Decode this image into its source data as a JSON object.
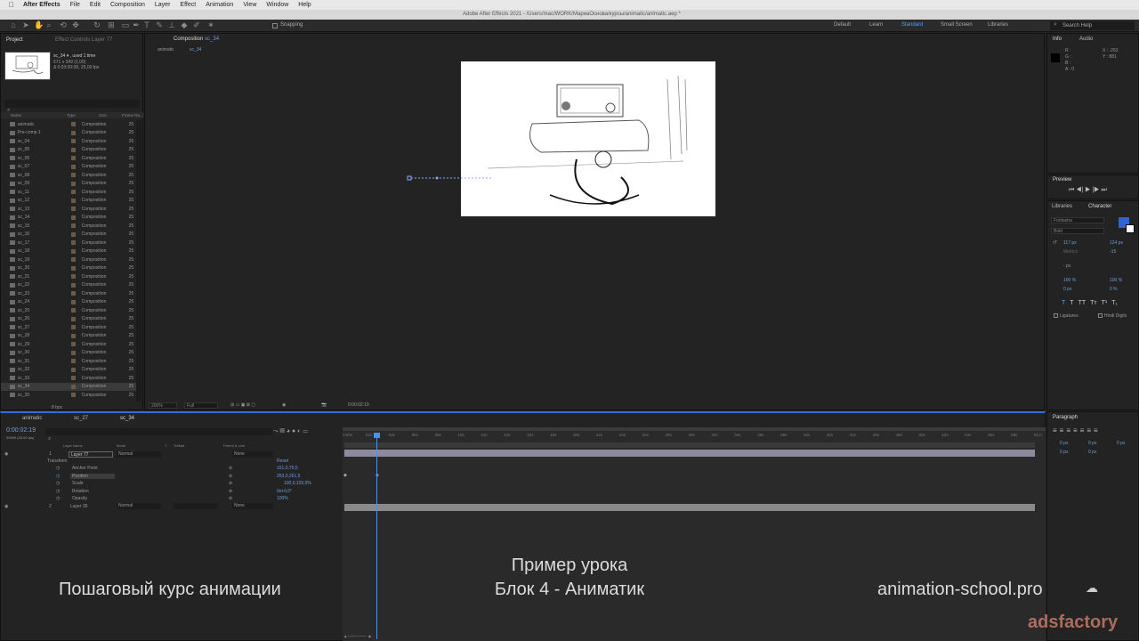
{
  "menubar": {
    "app": "After Effects",
    "items": [
      "File",
      "Edit",
      "Composition",
      "Layer",
      "Effect",
      "Animation",
      "View",
      "Window",
      "Help"
    ],
    "window_title": "Adobe After Effects 2021 - /Users/mac/WORK/МариаОснова/курсы/animatic/animatic.aep *"
  },
  "toolbar": {
    "snapping": "Snapping",
    "workspaces": [
      "Default",
      "Learn",
      "Standard",
      "Small Screen",
      "Libraries"
    ],
    "search": "Search Help"
  },
  "project": {
    "tab": "Project",
    "effect_tab": "Effect Controls Layer 77",
    "thumb_name": "sc_34 ▾ , used 1 time",
    "thumb_size": "571 x 349 (1,00)",
    "thumb_time": "Δ 0:03:00:08, 25,00 fps",
    "columns": [
      "Name",
      "Type",
      "Size",
      "Frame Ra..."
    ],
    "bpc": "8 bpc",
    "items": [
      {
        "name": "animatic",
        "type": "Composition",
        "fr": "25"
      },
      {
        "name": "Pre-comp 1",
        "type": "Composition",
        "fr": "25"
      },
      {
        "name": "sc_04",
        "type": "Composition",
        "fr": "25"
      },
      {
        "name": "sc_05",
        "type": "Composition",
        "fr": "25"
      },
      {
        "name": "sc_06",
        "type": "Composition",
        "fr": "25"
      },
      {
        "name": "sc_07",
        "type": "Composition",
        "fr": "25"
      },
      {
        "name": "sc_08",
        "type": "Composition",
        "fr": "25"
      },
      {
        "name": "sc_09",
        "type": "Composition",
        "fr": "25"
      },
      {
        "name": "sc_11",
        "type": "Composition",
        "fr": "25"
      },
      {
        "name": "sc_12",
        "type": "Composition",
        "fr": "25"
      },
      {
        "name": "sc_13",
        "type": "Composition",
        "fr": "25"
      },
      {
        "name": "sc_14",
        "type": "Composition",
        "fr": "25"
      },
      {
        "name": "sc_15",
        "type": "Composition",
        "fr": "25"
      },
      {
        "name": "sc_16",
        "type": "Composition",
        "fr": "25"
      },
      {
        "name": "sc_17",
        "type": "Composition",
        "fr": "25"
      },
      {
        "name": "sc_18",
        "type": "Composition",
        "fr": "25"
      },
      {
        "name": "sc_19",
        "type": "Composition",
        "fr": "25"
      },
      {
        "name": "sc_20",
        "type": "Composition",
        "fr": "25"
      },
      {
        "name": "sc_21",
        "type": "Composition",
        "fr": "25"
      },
      {
        "name": "sc_22",
        "type": "Composition",
        "fr": "25"
      },
      {
        "name": "sc_23",
        "type": "Composition",
        "fr": "25"
      },
      {
        "name": "sc_24",
        "type": "Composition",
        "fr": "25"
      },
      {
        "name": "sc_25",
        "type": "Composition",
        "fr": "25"
      },
      {
        "name": "sc_26",
        "type": "Composition",
        "fr": "25"
      },
      {
        "name": "sc_27",
        "type": "Composition",
        "fr": "25"
      },
      {
        "name": "sc_28",
        "type": "Composition",
        "fr": "25"
      },
      {
        "name": "sc_29",
        "type": "Composition",
        "fr": "25"
      },
      {
        "name": "sc_30",
        "type": "Composition",
        "fr": "25"
      },
      {
        "name": "sc_31",
        "type": "Composition",
        "fr": "25"
      },
      {
        "name": "sc_32",
        "type": "Composition",
        "fr": "25"
      },
      {
        "name": "sc_33",
        "type": "Composition",
        "fr": "25"
      },
      {
        "name": "sc_34",
        "type": "Composition",
        "fr": "25"
      },
      {
        "name": "sc_35",
        "type": "Composition",
        "fr": "25"
      }
    ]
  },
  "comp": {
    "tab": "Composition",
    "tab_name": "sc_34",
    "breadcrumb": [
      "animatic",
      "sc_34"
    ],
    "zoom": "200%",
    "resolution": "Full",
    "time": "0:00:02:19"
  },
  "info": {
    "tab": "Info",
    "audio_tab": "Audio",
    "r": "R :",
    "g": "G :",
    "b": "B :",
    "a": "A : 0",
    "x": "X : -262",
    "y": "Y : 881"
  },
  "preview": {
    "tab": "Preview"
  },
  "character": {
    "libraries_tab": "Libraries",
    "tab": "Character",
    "font": "Fontasha",
    "style": "Bold",
    "size": "117 px",
    "leading": "124 px",
    "kerning": "Metrics",
    "tracking": "-15",
    "stroke": "- px",
    "vscale": "100 %",
    "hscale": "100 %",
    "baseline": "0 px",
    "tsume": "0 %",
    "ligatures": "Ligatures",
    "hindi": "Hindi Digits",
    "styles": [
      "T",
      "T",
      "TT",
      "Tт",
      "T¹",
      "T₁"
    ]
  },
  "paragraph": {
    "tab": "Paragraph",
    "values": [
      "0 px",
      "0 px",
      "0 px",
      "0 px",
      "0 px"
    ]
  },
  "timeline": {
    "tabs": [
      "animatic",
      "sc_27",
      "sc_34"
    ],
    "time": "0:00:02:19",
    "frames": "00069 (25,00 fps)",
    "col_name": "Layer Name",
    "col_mode": "Mode",
    "col_t": "T",
    "col_trkmat": "TrkMat",
    "col_parent": "Parent & Link",
    "ticks": [
      "0:00s",
      "02s",
      "04s",
      "06s",
      "08s",
      "10s",
      "12s",
      "14s",
      "16s",
      "18s",
      "20s",
      "22s",
      "24s",
      "26s",
      "28s",
      "30s",
      "32s",
      "34s",
      "36s",
      "38s",
      "40s",
      "42s",
      "44s",
      "46s",
      "48s",
      "50s",
      "52s",
      "54s",
      "56s",
      "58s",
      "01:0"
    ],
    "layer1": {
      "num": "1",
      "name": "Layer 77",
      "mode": "Normal",
      "parent": "None"
    },
    "transform": "Transform",
    "reset": "Reset",
    "props": [
      {
        "name": "Anchor Point",
        "value": "151,0,75,5"
      },
      {
        "name": "Position",
        "value": "263,0,261,5"
      },
      {
        "name": "Scale",
        "value": "100,0,100,0%"
      },
      {
        "name": "Rotation",
        "value": "0x+0,0°"
      },
      {
        "name": "Opacity",
        "value": "100%"
      }
    ],
    "layer2": {
      "num": "2",
      "name": "Layer 26",
      "mode": "Normal",
      "trk": "None",
      "parent": "None"
    }
  },
  "captions": {
    "left": "Пошаговый курс анимации",
    "center1": "Пример урока",
    "center2": "Блок 4 - Аниматик",
    "right": "animation-school.pro",
    "watermark": "adsfactory"
  }
}
